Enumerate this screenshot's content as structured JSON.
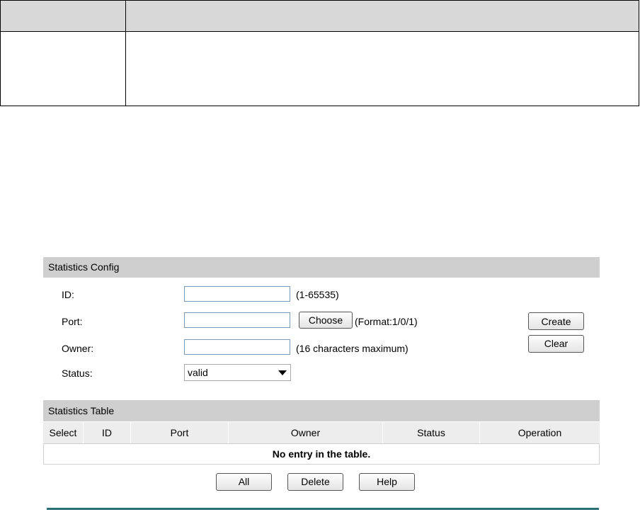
{
  "config": {
    "header": "Statistics Config",
    "id_label": "ID:",
    "id_hint": "(1-65535)",
    "port_label": "Port:",
    "choose_label": "Choose",
    "port_hint": "(Format:1/0/1)",
    "owner_label": "Owner:",
    "owner_hint": "(16 characters maximum)",
    "status_label": "Status:",
    "status_value": "valid",
    "create_label": "Create",
    "clear_label": "Clear"
  },
  "table": {
    "header": "Statistics Table",
    "columns": [
      "Select",
      "ID",
      "Port",
      "Owner",
      "Status",
      "Operation"
    ],
    "empty_message": "No entry in the table."
  },
  "actions": {
    "all_label": "All",
    "delete_label": "Delete",
    "help_label": "Help"
  }
}
